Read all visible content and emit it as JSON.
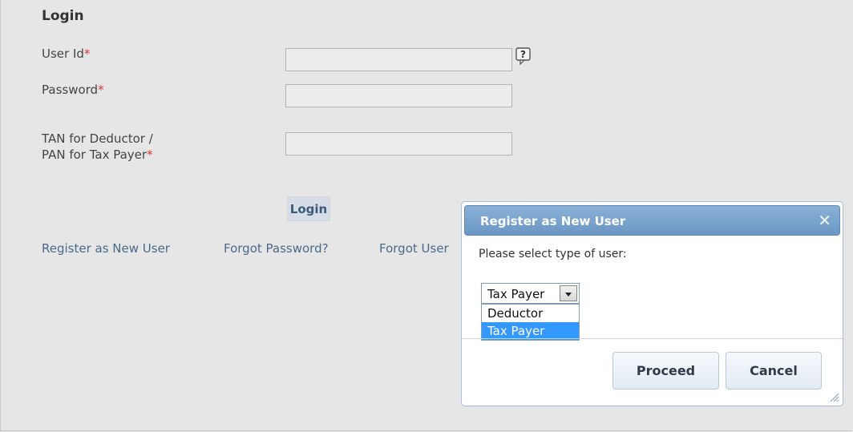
{
  "login": {
    "title": "Login",
    "user_id_label": "User Id",
    "password_label": "Password",
    "tan_label_line1": "TAN for Deductor /",
    "tan_label_line2": "PAN for Tax Payer",
    "required_marker": "*",
    "login_button": "Login",
    "help_icon": "question-icon"
  },
  "links": {
    "register": "Register as New User",
    "forgot_password": "Forgot Password?",
    "forgot_user": "Forgot User"
  },
  "dialog": {
    "title": "Register as New User",
    "close_symbol": "✕",
    "prompt": "Please select type of user:",
    "selected_value": "Tax Payer",
    "options": [
      "Deductor",
      "Tax Payer"
    ],
    "proceed_button": "Proceed",
    "cancel_button": "Cancel"
  },
  "colors": {
    "required": "#e0362c",
    "link": "#4a6a8a",
    "dialog_header": "#7aa3cf",
    "option_highlight": "#3399ff"
  }
}
